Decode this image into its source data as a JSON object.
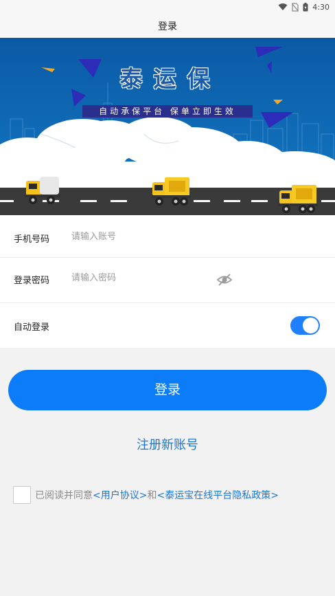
{
  "status_bar": {
    "time": "4:30",
    "icons": [
      "wifi-icon",
      "no-sim-icon",
      "battery-icon"
    ]
  },
  "app_bar": {
    "title": "登录"
  },
  "banner": {
    "title": "泰运保",
    "slogan": "自动承保平台  保单立即生效"
  },
  "form": {
    "phone": {
      "label": "手机号码",
      "placeholder": "请输入账号",
      "value": ""
    },
    "password": {
      "label": "登录密码",
      "placeholder": "请输入密码",
      "value": "",
      "visibility_icon": "eye-off-icon"
    },
    "auto_login": {
      "label": "自动登录",
      "enabled": true
    }
  },
  "login_button": {
    "label": "登录"
  },
  "register_link": {
    "label": "注册新账号"
  },
  "agreement": {
    "checked": false,
    "prefix": "已阅读并同意",
    "user_agreement": "<用户协议>",
    "conjunction": "和",
    "privacy_policy": "<泰运宝在线平台隐私政策>"
  },
  "colors": {
    "primary": "#0d7cf9",
    "link": "#1a76d9",
    "banner_sky": "#0c66ad",
    "toggle_on": "#1e7fff"
  }
}
